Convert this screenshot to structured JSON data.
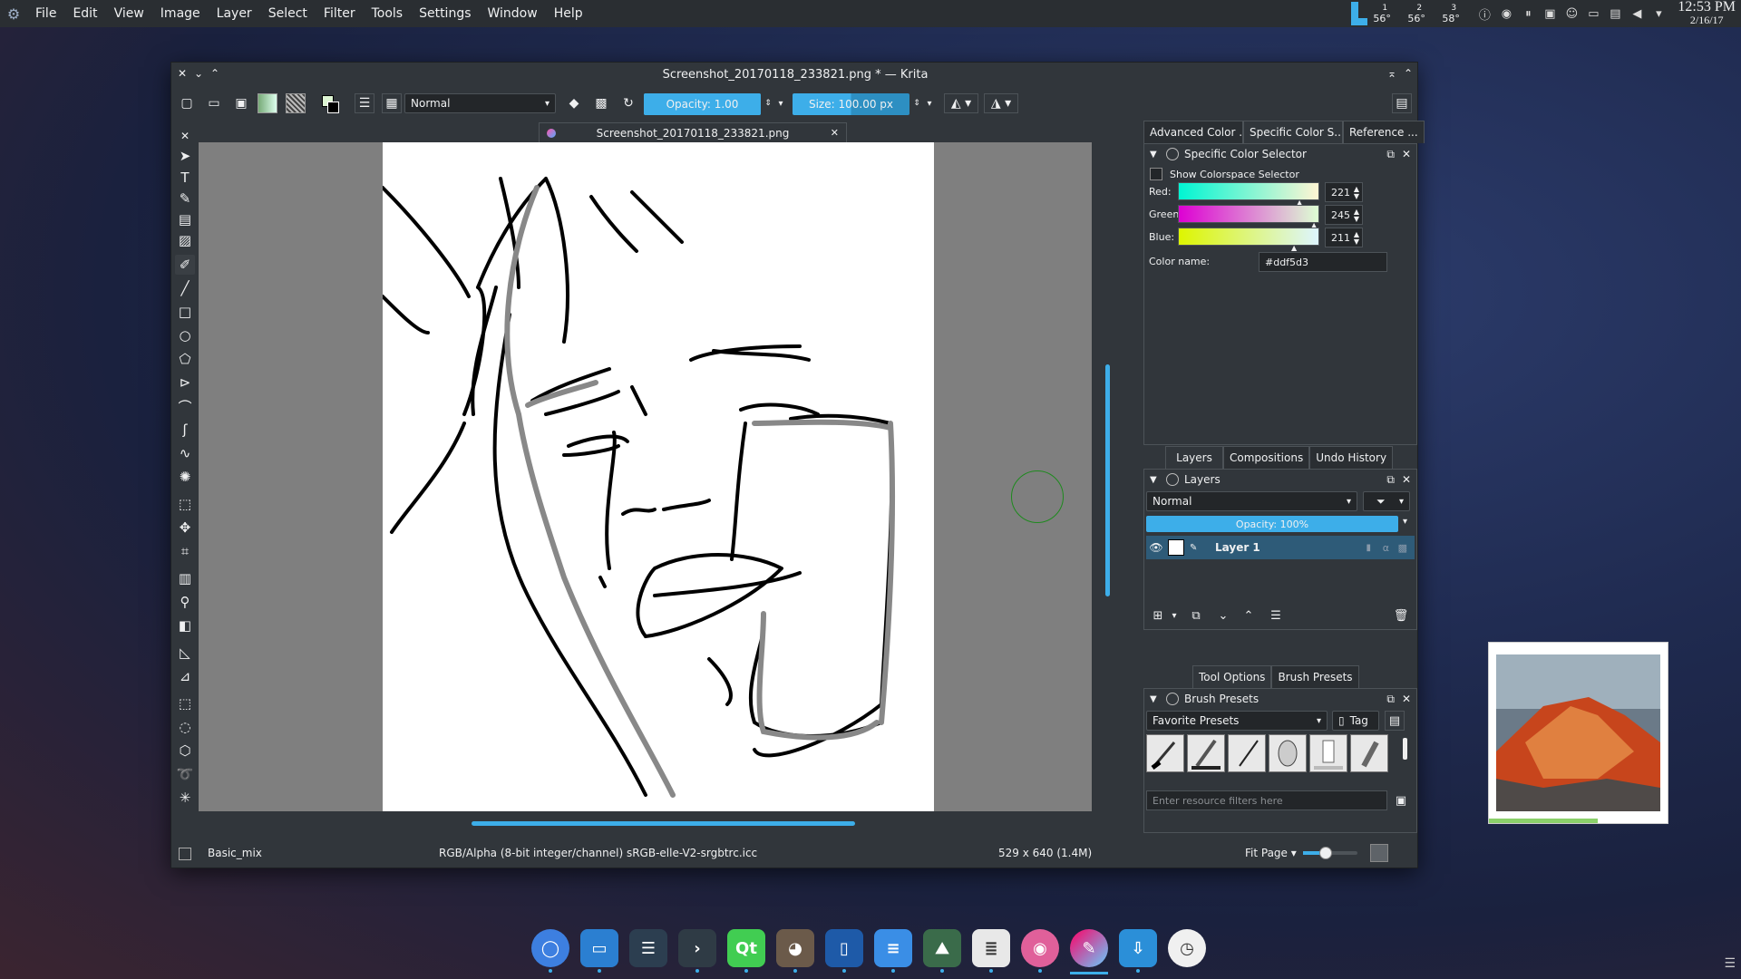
{
  "panel": {
    "menu": [
      "File",
      "Edit",
      "View",
      "Image",
      "Layer",
      "Select",
      "Filter",
      "Tools",
      "Settings",
      "Window",
      "Help"
    ],
    "temps": [
      {
        "n": "1",
        "v": "56°"
      },
      {
        "n": "2",
        "v": "56°"
      },
      {
        "n": "3",
        "v": "58°"
      }
    ],
    "clock_time": "12:53 PM",
    "clock_date": "2/16/17"
  },
  "window": {
    "title": "Screenshot_20170118_233821.png * — Krita",
    "doc_tab": "Screenshot_20170118_233821.png"
  },
  "toolbar": {
    "blend_mode": "Normal",
    "opacity_label": "Opacity:  1.00",
    "opacity_level": 1.0,
    "size_label": "Size:  100.00 px"
  },
  "status": {
    "brush": "Basic_mix",
    "colorspace": "RGB/Alpha (8-bit integer/channel)  sRGB-elle-V2-srgbtrc.icc",
    "dims": "529 x 640 (1.4M)",
    "zoom": "Fit Page"
  },
  "dock": {
    "top_tabs": [
      "Advanced Color ...",
      "Specific Color S...",
      "Reference ..."
    ],
    "color_selector": {
      "title": "Specific Color Selector",
      "show_cs": "Show Colorspace Selector",
      "red_label": "Red:",
      "red": "221",
      "green_label": "Green:",
      "green": "245",
      "blue_label": "Blue:",
      "blue": "211",
      "name_label": "Color name:",
      "name": "#ddf5d3"
    },
    "mid_tabs": [
      "Layers",
      "Compositions",
      "Undo History"
    ],
    "layers": {
      "title": "Layers",
      "mode": "Normal",
      "opacity": "Opacity:  100%",
      "opacity_level": 1.0,
      "layer_name": "Layer 1"
    },
    "bottom_tabs": [
      "Tool Options",
      "Brush Presets"
    ],
    "presets": {
      "title": "Brush Presets",
      "tag_select": "Favorite Presets",
      "tag_btn": "Tag",
      "filter_placeholder": "Enter resource filters here"
    }
  },
  "colors": {
    "accent": "#3daee9",
    "panel": "#31363b",
    "canvas": "#7f7f7f"
  }
}
